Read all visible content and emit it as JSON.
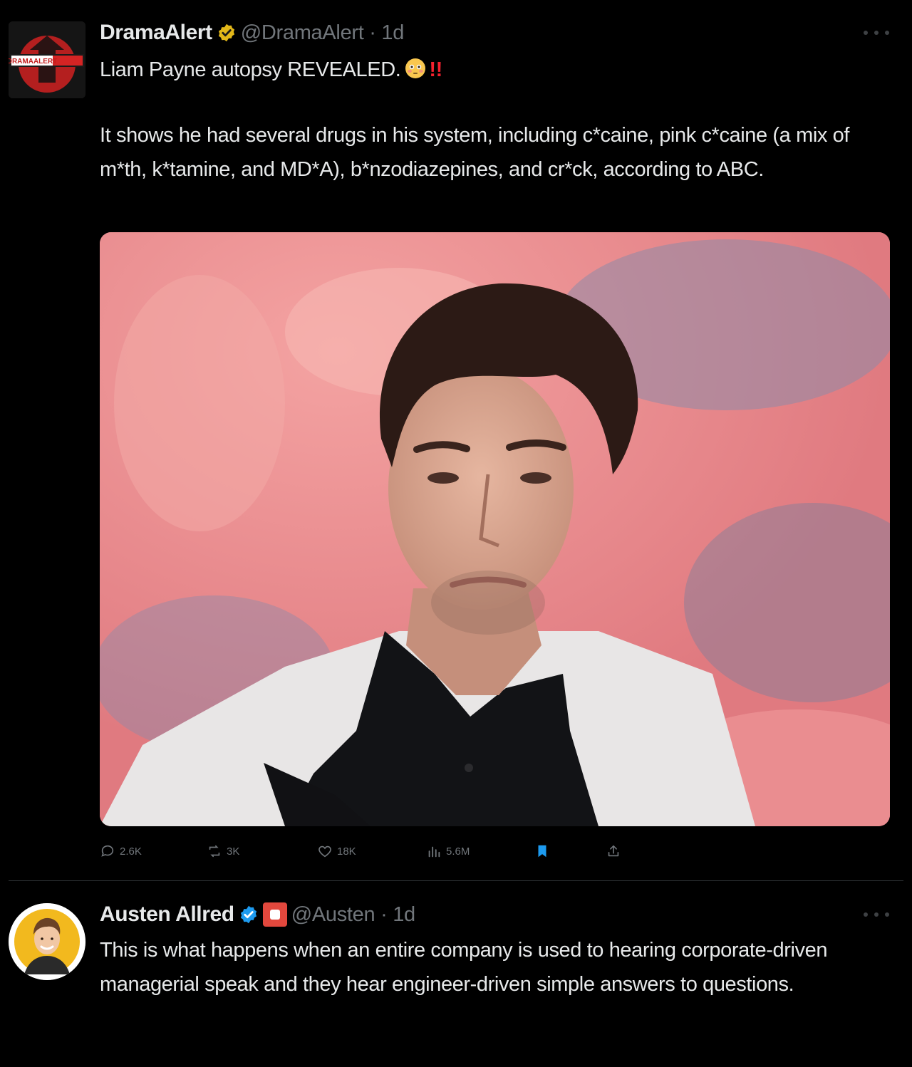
{
  "tweets": [
    {
      "display_name": "DramaAlert",
      "handle_time": "@DramaAlert · 1d",
      "headline": "Liam Payne autopsy REVEALED.",
      "headline_bangs": "!!",
      "body": "It shows he had several drugs in his system, including c*caine, pink c*caine (a mix of m*th, k*tamine, and MD*A), b*nzodiazepines, and cr*ck, according to ABC.",
      "avatar_logo_text": "DRAMAALERT",
      "actions": {
        "replies": "2.6K",
        "reposts": "3K",
        "likes": "18K",
        "views": "5.6M"
      }
    },
    {
      "display_name": "Austen Allred",
      "handle_time": "@Austen · 1d",
      "body": "This is what happens when an entire company is used to hearing corporate-driven managerial speak and they hear engineer-driven simple answers to questions."
    }
  ],
  "colors": {
    "background": "#000000",
    "text_primary": "#e7e9ea",
    "text_secondary": "#71767b",
    "verified_blue": "#1d9bf0",
    "verified_gold": "#e2b719",
    "bookmark_active": "#1d9bf0",
    "alert_red": "#f4212e"
  },
  "icons": {
    "reply": "speech-bubble-icon",
    "repost": "repost-arrows-icon",
    "like": "heart-icon",
    "views": "bar-chart-icon",
    "bookmark": "bookmark-filled-icon",
    "share": "upload-arrow-icon",
    "more": "ellipsis-icon"
  }
}
